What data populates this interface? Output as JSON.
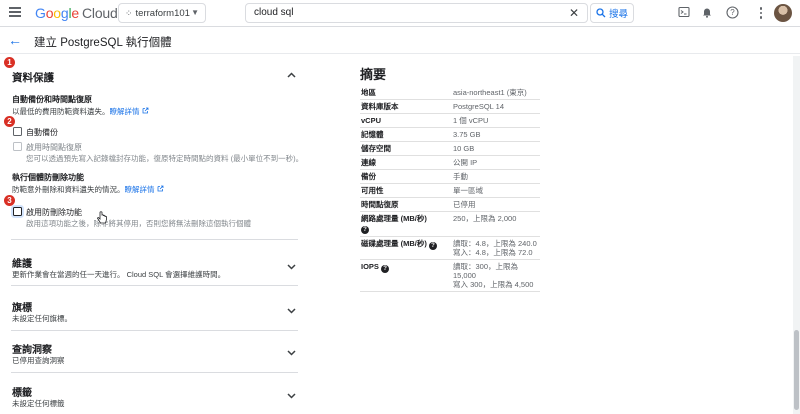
{
  "topbar": {
    "logo_google": [
      "G",
      "o",
      "o",
      "g",
      "l",
      "e"
    ],
    "logo_cloud": "Cloud",
    "project_name": "terraform101",
    "search_value": "cloud sql",
    "search_button": "搜尋"
  },
  "page": {
    "title": "建立 PostgreSQL 執行個體"
  },
  "data_protection": {
    "badge1": "1",
    "title": "資料保護",
    "backup_heading": "自動備份和時間點復原",
    "backup_desc": "以最低的費用防範資料遺失。",
    "learn_more": "瞭解詳情",
    "badge2": "2",
    "auto_backup_label": "自動備份",
    "pitr_label": "啟用時間點復原",
    "pitr_desc": "您可以透過預先寫入記錄檔封存功能，復原特定時間點的資料 (最小單位不到一秒)。",
    "deletion_heading": "執行個體防刪除功能",
    "deletion_desc": "防範意外刪除和資料遺失的情況。",
    "learn_more2": "瞭解詳情",
    "badge3": "3",
    "deletion_protect_label": "啟用防刪除功能",
    "deletion_protect_desc": "啟用這項功能之後，除非將其停用，否則您將無法刪除這個執行個體"
  },
  "sections": [
    {
      "title": "維護",
      "desc": "更新作業會在當週的任一天進行。 Cloud SQL 會選擇維護時間。"
    },
    {
      "title": "旗標",
      "desc": "未設定任何旗標。"
    },
    {
      "title": "查詢洞察",
      "desc": "已停用查詢洞察"
    },
    {
      "title": "標籤",
      "desc": "未設定任何標籤"
    }
  ],
  "summary": {
    "title": "摘要",
    "rows": [
      {
        "k": "地區",
        "v": "asia-northeast1 (東京)"
      },
      {
        "k": "資料庫版本",
        "v": "PostgreSQL 14"
      },
      {
        "k": "vCPU",
        "v": "1 個 vCPU"
      },
      {
        "k": "記憶體",
        "v": "3.75 GB"
      },
      {
        "k": "儲存空間",
        "v": "10 GB"
      },
      {
        "k": "連線",
        "v": "公開 IP"
      },
      {
        "k": "備份",
        "v": "手動"
      },
      {
        "k": "可用性",
        "v": "單一區域"
      },
      {
        "k": "時間點復原",
        "v": "已停用"
      }
    ],
    "network_k": "網路處理量 (MB/秒)",
    "network_v": "250，上限為 2,000",
    "disk_k": "磁碟處理量 (MB/秒)",
    "disk_v1": "讀取：4.8，上限為 240.0",
    "disk_v2": "寫入：4.8，上限為 72.0",
    "iops_k": "IOPS",
    "iops_v1": "讀取：300，上限為 15,000",
    "iops_v2": "寫入 300，上限為 4,500",
    "help_glyph": "?"
  },
  "colors": {
    "accent": "#1a73e8",
    "badge": "#d93025"
  }
}
